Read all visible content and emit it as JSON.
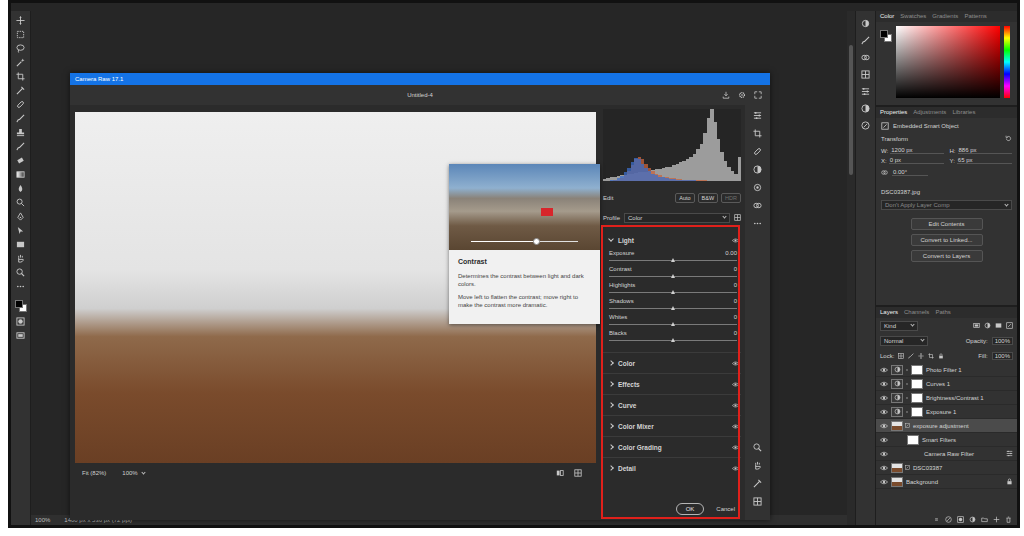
{
  "status_bar": {
    "zoom": "100%",
    "doc_size": "1400 px x 536 px (72 ppi)"
  },
  "camera_raw": {
    "title": "Camera Raw 17.1",
    "document": "Untitled-4",
    "zoom_fit": "Fit (82%)",
    "zoom_actual": "100%",
    "histogram": {
      "series": [
        {
          "color": "#9c9c9c",
          "values": [
            3,
            4,
            5,
            6,
            7,
            8,
            9,
            10,
            10,
            11,
            12,
            12,
            13,
            14,
            15,
            16,
            17,
            18,
            19,
            20,
            22,
            24,
            26,
            28,
            31,
            34,
            38,
            44,
            52,
            66,
            88,
            100,
            82,
            58,
            40,
            28,
            20,
            14,
            10,
            34
          ]
        },
        {
          "color": "#c8643c",
          "values": [
            0,
            0,
            0,
            1,
            2,
            4,
            8,
            14,
            22,
            30,
            34,
            30,
            24,
            18,
            14,
            10,
            8,
            6,
            5,
            4,
            4,
            3,
            3,
            2,
            2,
            2,
            1,
            1,
            1,
            1,
            0,
            0,
            0,
            0,
            0,
            0,
            0,
            0,
            0,
            0
          ]
        },
        {
          "color": "#3c6ec8",
          "values": [
            0,
            0,
            1,
            2,
            4,
            7,
            12,
            18,
            26,
            32,
            30,
            24,
            18,
            14,
            10,
            8,
            6,
            5,
            4,
            3,
            3,
            2,
            2,
            1,
            1,
            1,
            1,
            0,
            0,
            0,
            0,
            0,
            0,
            0,
            0,
            0,
            0,
            0,
            0,
            0
          ]
        }
      ]
    },
    "edit": {
      "title": "Edit",
      "buttons": [
        {
          "label": "Auto",
          "disabled": false
        },
        {
          "label": "B&W",
          "disabled": false
        },
        {
          "label": "HDR",
          "disabled": true
        }
      ]
    },
    "profile": {
      "label": "Profile",
      "value": "Color"
    },
    "light": {
      "title": "Light",
      "expanded": true,
      "sliders": [
        {
          "name": "Exposure",
          "value": "0.00",
          "level": 0.5
        },
        {
          "name": "Contrast",
          "value": "0",
          "level": 0.5
        },
        {
          "name": "Highlights",
          "value": "0",
          "level": 0.5
        },
        {
          "name": "Shadows",
          "value": "0",
          "level": 0.5
        },
        {
          "name": "Whites",
          "value": "0",
          "level": 0.5
        },
        {
          "name": "Blacks",
          "value": "0",
          "level": 0.5
        }
      ]
    },
    "sections": [
      {
        "title": "Color",
        "expanded": false
      },
      {
        "title": "Effects",
        "expanded": false
      },
      {
        "title": "Curve",
        "expanded": false
      },
      {
        "title": "Color Mixer",
        "expanded": false
      },
      {
        "title": "Color Grading",
        "expanded": false
      },
      {
        "title": "Detail",
        "expanded": false
      }
    ],
    "buttons": [
      {
        "label": "OK"
      },
      {
        "label": "Cancel"
      }
    ]
  },
  "tooltip": {
    "title": "Contrast",
    "text": [
      "Determines the contrast between light and dark colors.",
      "Move left to flatten the contrast; move right to make the contrast more dramatic."
    ],
    "level": 0.62
  },
  "color_panel": {
    "tabs": [
      {
        "label": "Color",
        "selected": true
      },
      {
        "label": "Swatches",
        "selected": false
      },
      {
        "label": "Gradients",
        "selected": false
      },
      {
        "label": "Patterns",
        "selected": false
      }
    ]
  },
  "properties": {
    "tabs": [
      {
        "label": "Properties",
        "selected": true
      },
      {
        "label": "Adjustments",
        "selected": false
      },
      {
        "label": "Libraries",
        "selected": false
      }
    ],
    "kind": "Embedded Smart Object",
    "section": "Transform",
    "fields": [
      {
        "label": "W:",
        "value": "1200 px"
      },
      {
        "label": "H:",
        "value": "886 px"
      },
      {
        "label": "X:",
        "value": "0 px"
      },
      {
        "label": "Y:",
        "value": "65 px"
      }
    ],
    "angle": "0.00°",
    "file": "DSC03387.jpg",
    "comp": "Don't Apply Layer Comp",
    "buttons": [
      "Edit Contents",
      "Convert to Linked...",
      "Convert to Layers"
    ]
  },
  "layers_panel": {
    "tabs": [
      {
        "label": "Layers",
        "selected": true
      },
      {
        "label": "Channels",
        "selected": false
      },
      {
        "label": "Paths",
        "selected": false
      }
    ],
    "filter": "Kind",
    "blend_mode": "Normal",
    "opacity_label": "Opacity:",
    "opacity": "100%",
    "lock_label": "Lock:",
    "fill_label": "Fill:",
    "fill": "100%",
    "layers": [
      {
        "name": "Photo Filter 1",
        "kind": "adjustment",
        "visible": true,
        "selected": false
      },
      {
        "name": "Curves 1",
        "kind": "adjustment",
        "visible": true,
        "selected": false
      },
      {
        "name": "Brightness/Contrast 1",
        "kind": "adjustment",
        "visible": true,
        "selected": false
      },
      {
        "name": "Exposure 1",
        "kind": "adjustment",
        "visible": true,
        "selected": false
      },
      {
        "name": "exposure adjustment",
        "kind": "smart",
        "visible": true,
        "selected": true
      },
      {
        "name": "Smart Filters",
        "kind": "filters",
        "visible": true,
        "selected": false
      },
      {
        "name": "Camera Raw Filter",
        "kind": "filter",
        "visible": true,
        "selected": false
      },
      {
        "name": "DSC03387",
        "kind": "smart",
        "visible": true,
        "selected": false
      },
      {
        "name": "Background",
        "kind": "background",
        "visible": true,
        "selected": false
      }
    ]
  }
}
